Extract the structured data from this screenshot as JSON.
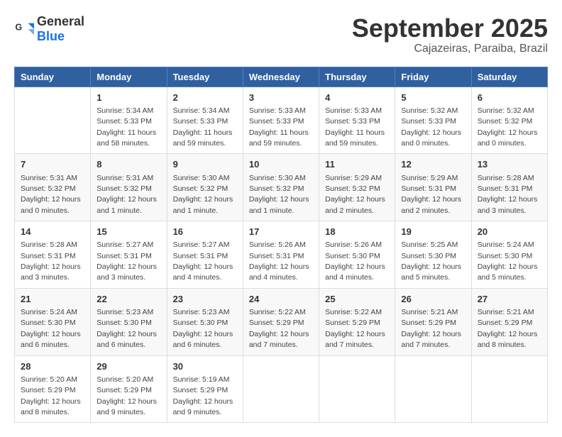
{
  "header": {
    "logo_general": "General",
    "logo_blue": "Blue",
    "month": "September 2025",
    "location": "Cajazeiras, Paraiba, Brazil"
  },
  "days_of_week": [
    "Sunday",
    "Monday",
    "Tuesday",
    "Wednesday",
    "Thursday",
    "Friday",
    "Saturday"
  ],
  "weeks": [
    [
      {
        "day": "",
        "info": ""
      },
      {
        "day": "1",
        "info": "Sunrise: 5:34 AM\nSunset: 5:33 PM\nDaylight: 11 hours\nand 58 minutes."
      },
      {
        "day": "2",
        "info": "Sunrise: 5:34 AM\nSunset: 5:33 PM\nDaylight: 11 hours\nand 59 minutes."
      },
      {
        "day": "3",
        "info": "Sunrise: 5:33 AM\nSunset: 5:33 PM\nDaylight: 11 hours\nand 59 minutes."
      },
      {
        "day": "4",
        "info": "Sunrise: 5:33 AM\nSunset: 5:33 PM\nDaylight: 11 hours\nand 59 minutes."
      },
      {
        "day": "5",
        "info": "Sunrise: 5:32 AM\nSunset: 5:33 PM\nDaylight: 12 hours\nand 0 minutes."
      },
      {
        "day": "6",
        "info": "Sunrise: 5:32 AM\nSunset: 5:32 PM\nDaylight: 12 hours\nand 0 minutes."
      }
    ],
    [
      {
        "day": "7",
        "info": "Sunrise: 5:31 AM\nSunset: 5:32 PM\nDaylight: 12 hours\nand 0 minutes."
      },
      {
        "day": "8",
        "info": "Sunrise: 5:31 AM\nSunset: 5:32 PM\nDaylight: 12 hours\nand 1 minute."
      },
      {
        "day": "9",
        "info": "Sunrise: 5:30 AM\nSunset: 5:32 PM\nDaylight: 12 hours\nand 1 minute."
      },
      {
        "day": "10",
        "info": "Sunrise: 5:30 AM\nSunset: 5:32 PM\nDaylight: 12 hours\nand 1 minute."
      },
      {
        "day": "11",
        "info": "Sunrise: 5:29 AM\nSunset: 5:32 PM\nDaylight: 12 hours\nand 2 minutes."
      },
      {
        "day": "12",
        "info": "Sunrise: 5:29 AM\nSunset: 5:31 PM\nDaylight: 12 hours\nand 2 minutes."
      },
      {
        "day": "13",
        "info": "Sunrise: 5:28 AM\nSunset: 5:31 PM\nDaylight: 12 hours\nand 3 minutes."
      }
    ],
    [
      {
        "day": "14",
        "info": "Sunrise: 5:28 AM\nSunset: 5:31 PM\nDaylight: 12 hours\nand 3 minutes."
      },
      {
        "day": "15",
        "info": "Sunrise: 5:27 AM\nSunset: 5:31 PM\nDaylight: 12 hours\nand 3 minutes."
      },
      {
        "day": "16",
        "info": "Sunrise: 5:27 AM\nSunset: 5:31 PM\nDaylight: 12 hours\nand 4 minutes."
      },
      {
        "day": "17",
        "info": "Sunrise: 5:26 AM\nSunset: 5:31 PM\nDaylight: 12 hours\nand 4 minutes."
      },
      {
        "day": "18",
        "info": "Sunrise: 5:26 AM\nSunset: 5:30 PM\nDaylight: 12 hours\nand 4 minutes."
      },
      {
        "day": "19",
        "info": "Sunrise: 5:25 AM\nSunset: 5:30 PM\nDaylight: 12 hours\nand 5 minutes."
      },
      {
        "day": "20",
        "info": "Sunrise: 5:24 AM\nSunset: 5:30 PM\nDaylight: 12 hours\nand 5 minutes."
      }
    ],
    [
      {
        "day": "21",
        "info": "Sunrise: 5:24 AM\nSunset: 5:30 PM\nDaylight: 12 hours\nand 6 minutes."
      },
      {
        "day": "22",
        "info": "Sunrise: 5:23 AM\nSunset: 5:30 PM\nDaylight: 12 hours\nand 6 minutes."
      },
      {
        "day": "23",
        "info": "Sunrise: 5:23 AM\nSunset: 5:30 PM\nDaylight: 12 hours\nand 6 minutes."
      },
      {
        "day": "24",
        "info": "Sunrise: 5:22 AM\nSunset: 5:29 PM\nDaylight: 12 hours\nand 7 minutes."
      },
      {
        "day": "25",
        "info": "Sunrise: 5:22 AM\nSunset: 5:29 PM\nDaylight: 12 hours\nand 7 minutes."
      },
      {
        "day": "26",
        "info": "Sunrise: 5:21 AM\nSunset: 5:29 PM\nDaylight: 12 hours\nand 7 minutes."
      },
      {
        "day": "27",
        "info": "Sunrise: 5:21 AM\nSunset: 5:29 PM\nDaylight: 12 hours\nand 8 minutes."
      }
    ],
    [
      {
        "day": "28",
        "info": "Sunrise: 5:20 AM\nSunset: 5:29 PM\nDaylight: 12 hours\nand 8 minutes."
      },
      {
        "day": "29",
        "info": "Sunrise: 5:20 AM\nSunset: 5:29 PM\nDaylight: 12 hours\nand 9 minutes."
      },
      {
        "day": "30",
        "info": "Sunrise: 5:19 AM\nSunset: 5:29 PM\nDaylight: 12 hours\nand 9 minutes."
      },
      {
        "day": "",
        "info": ""
      },
      {
        "day": "",
        "info": ""
      },
      {
        "day": "",
        "info": ""
      },
      {
        "day": "",
        "info": ""
      }
    ]
  ]
}
